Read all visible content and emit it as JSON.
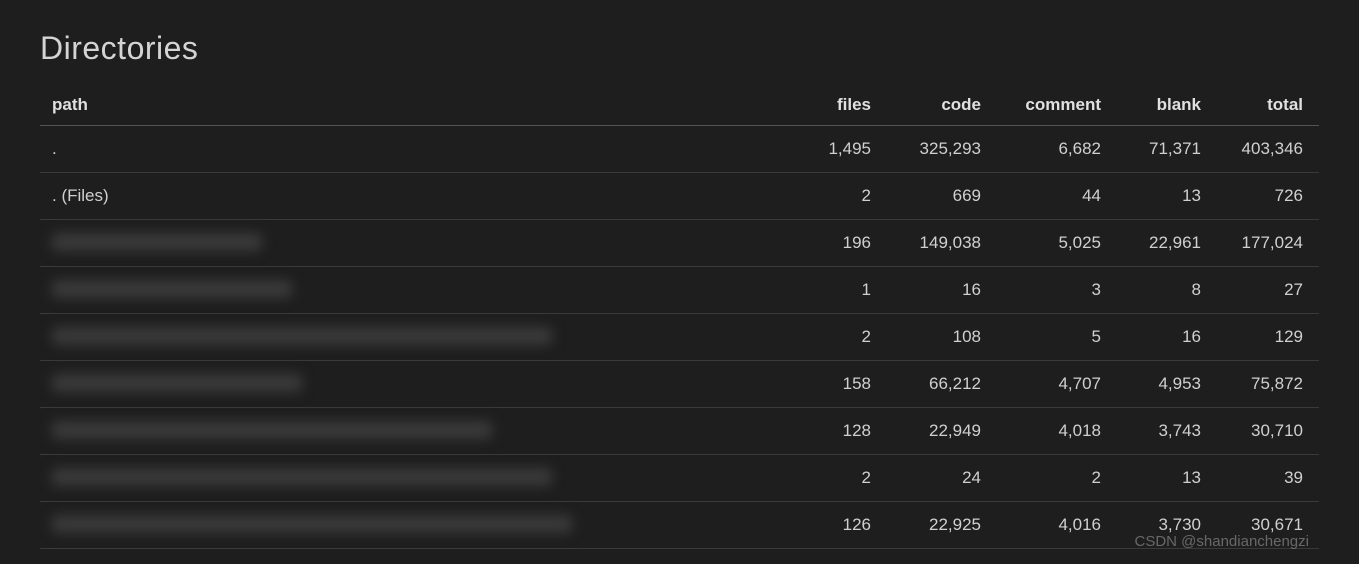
{
  "title": "Directories",
  "columns": {
    "path": "path",
    "files": "files",
    "code": "code",
    "comment": "comment",
    "blank": "blank",
    "total": "total"
  },
  "rows": [
    {
      "path": ".",
      "files": "1,495",
      "code": "325,293",
      "comment": "6,682",
      "blank": "71,371",
      "total": "403,346",
      "blurred": false
    },
    {
      "path": ". (Files)",
      "files": "2",
      "code": "669",
      "comment": "44",
      "blank": "13",
      "total": "726",
      "blurred": false
    },
    {
      "path": "",
      "files": "196",
      "code": "149,038",
      "comment": "5,025",
      "blank": "22,961",
      "total": "177,024",
      "blurred": true,
      "blur_width": 210
    },
    {
      "path": "",
      "files": "1",
      "code": "16",
      "comment": "3",
      "blank": "8",
      "total": "27",
      "blurred": true,
      "blur_width": 240
    },
    {
      "path": "",
      "files": "2",
      "code": "108",
      "comment": "5",
      "blank": "16",
      "total": "129",
      "blurred": true,
      "blur_width": 500
    },
    {
      "path": "",
      "files": "158",
      "code": "66,212",
      "comment": "4,707",
      "blank": "4,953",
      "total": "75,872",
      "blurred": true,
      "blur_width": 250
    },
    {
      "path": "",
      "files": "128",
      "code": "22,949",
      "comment": "4,018",
      "blank": "3,743",
      "total": "30,710",
      "blurred": true,
      "blur_width": 440
    },
    {
      "path": "",
      "files": "2",
      "code": "24",
      "comment": "2",
      "blank": "13",
      "total": "39",
      "blurred": true,
      "blur_width": 500
    },
    {
      "path": "",
      "files": "126",
      "code": "22,925",
      "comment": "4,016",
      "blank": "3,730",
      "total": "30,671",
      "blurred": true,
      "blur_width": 520
    }
  ],
  "watermark": "CSDN @shandianchengzi"
}
